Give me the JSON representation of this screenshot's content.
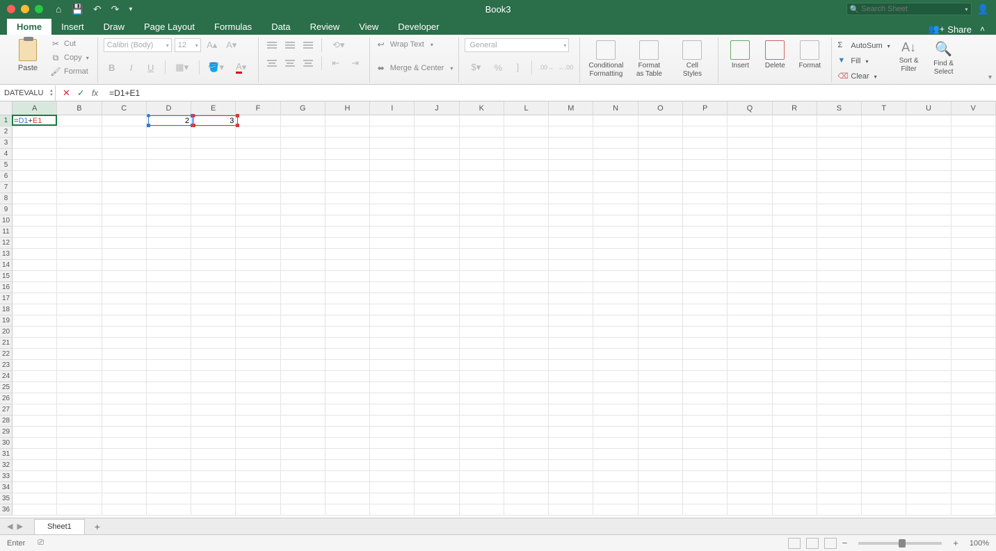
{
  "app": {
    "title": "Book3"
  },
  "search": {
    "placeholder": "Search Sheet"
  },
  "tabs": [
    "Home",
    "Insert",
    "Draw",
    "Page Layout",
    "Formulas",
    "Data",
    "Review",
    "View",
    "Developer"
  ],
  "tabs_active": "Home",
  "share": {
    "label": "Share"
  },
  "clipboard": {
    "paste": "Paste",
    "cut": "Cut",
    "copy": "Copy",
    "format": "Format"
  },
  "font": {
    "name": "Calibri (Body)",
    "size": "12"
  },
  "alignment": {
    "wrap": "Wrap Text",
    "merge": "Merge & Center"
  },
  "number": {
    "format": "General"
  },
  "styles": {
    "conditional": "Conditional\nFormatting",
    "format_table": "Format\nas Table",
    "cell_styles": "Cell\nStyles"
  },
  "cells": {
    "insert": "Insert",
    "delete": "Delete",
    "format": "Format"
  },
  "editing": {
    "autosum": "AutoSum",
    "fill": "Fill",
    "clear": "Clear",
    "sort": "Sort &\nFilter",
    "find": "Find &\nSelect"
  },
  "formula_bar": {
    "name_box": "DATEVALU",
    "formula": "=D1+E1"
  },
  "grid": {
    "columns": [
      "A",
      "B",
      "C",
      "D",
      "E",
      "F",
      "G",
      "H",
      "I",
      "J",
      "K",
      "L",
      "M",
      "N",
      "O",
      "P",
      "Q",
      "R",
      "S",
      "T",
      "U",
      "V"
    ],
    "row_count": 36,
    "active_cell": "A1",
    "active_formula_parts": {
      "prefix": "=",
      "ref1": "D1",
      "op": "+",
      "ref2": "E1"
    },
    "cells": {
      "D1": "2",
      "E1": "3"
    },
    "ref_highlights": [
      {
        "cell": "D1",
        "color": "blue"
      },
      {
        "cell": "E1",
        "color": "red"
      }
    ]
  },
  "sheets": {
    "tabs": [
      "Sheet1"
    ],
    "active": "Sheet1"
  },
  "status": {
    "mode": "Enter",
    "zoom": "100%"
  }
}
